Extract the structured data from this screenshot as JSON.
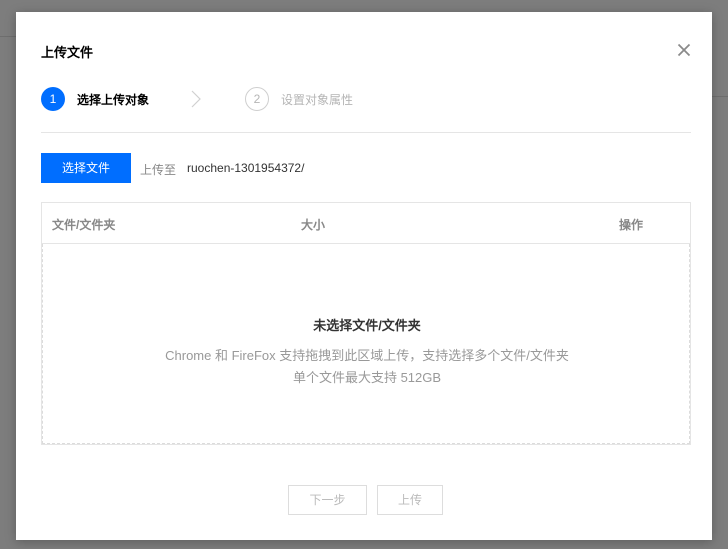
{
  "dialog": {
    "title": "上传文件"
  },
  "steps": [
    {
      "number": "1",
      "label": "选择上传对象",
      "state": "active"
    },
    {
      "number": "2",
      "label": "设置对象属性",
      "state": "pending"
    }
  ],
  "toolbar": {
    "select_file_label": "选择文件",
    "upload_to_label": "上传至",
    "upload_path": "ruochen-1301954372/"
  },
  "table": {
    "columns": [
      "文件/文件夹",
      "大小",
      "操作"
    ]
  },
  "empty_state": {
    "title": "未选择文件/文件夹",
    "hint": "Chrome 和 FireFox 支持拖拽到此区域上传，支持选择多个文件/文件夹",
    "limit": "单个文件最大支持 512GB"
  },
  "footer": {
    "next_label": "下一步",
    "upload_label": "上传"
  },
  "colors": {
    "accent": "#006eff",
    "overlay": "#7d7d7d",
    "disabled_text": "#bbbbbb"
  },
  "icons": {
    "close": "close-icon",
    "step_separator": "chevron-right-icon"
  }
}
